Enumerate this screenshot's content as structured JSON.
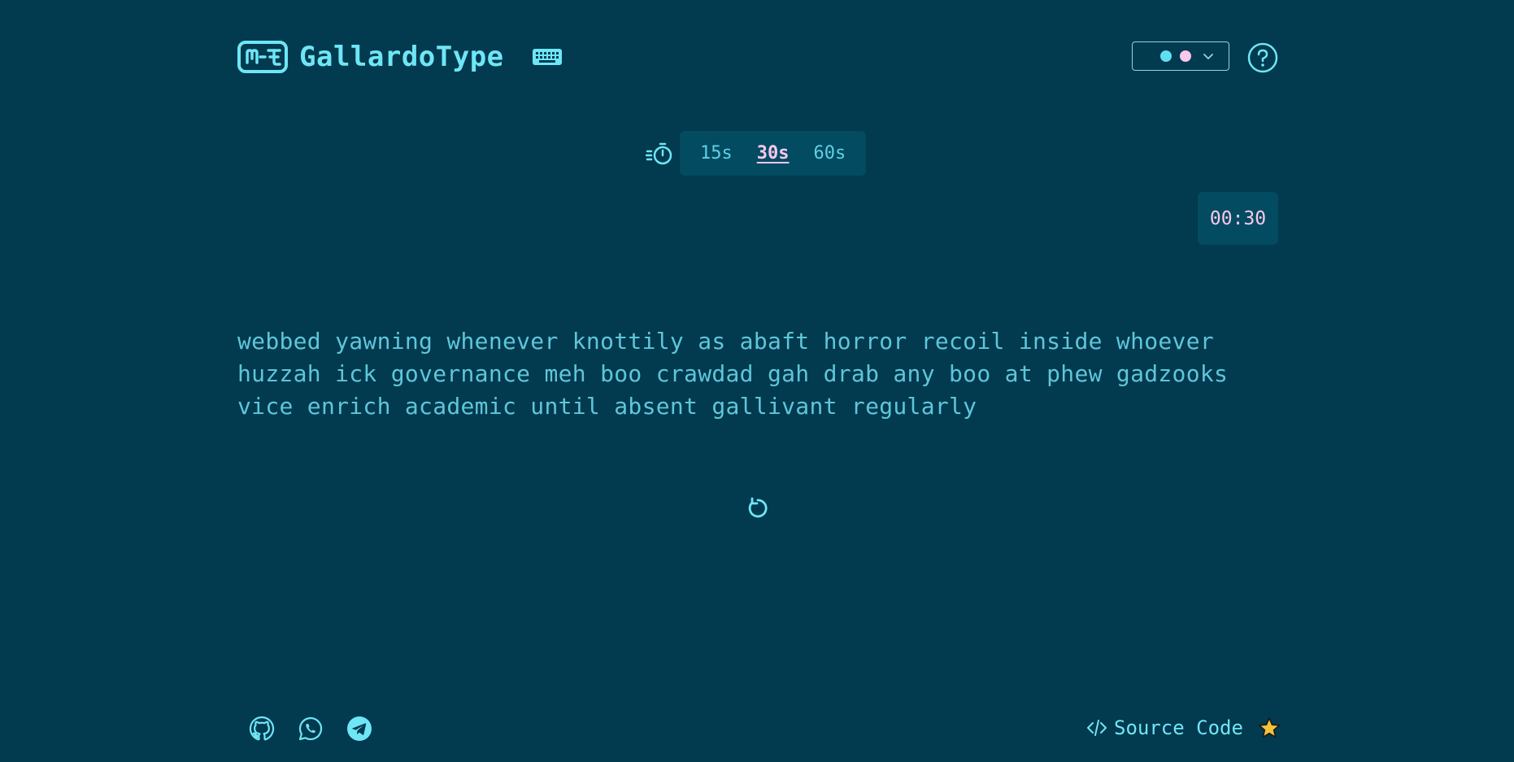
{
  "header": {
    "brand_name": "GallardoType",
    "theme_colors": [
      "#033b4d",
      "#5fe0ef",
      "#f8c8ec"
    ]
  },
  "timer": {
    "options": [
      "15s",
      "30s",
      "60s"
    ],
    "selected": "30s",
    "countdown": "00:30"
  },
  "words": {
    "text": "webbed yawning whenever knottily as abaft horror recoil inside whoever huzzah ick governance meh boo crawdad gah drab any boo at phew gadzooks vice enrich academic until absent gallivant regularly"
  },
  "footer": {
    "source_label": "Source Code"
  },
  "colors": {
    "background": "#023a4f",
    "accent": "#6ee6f5",
    "highlight": "#f8c8ec",
    "panel": "#034b60"
  }
}
